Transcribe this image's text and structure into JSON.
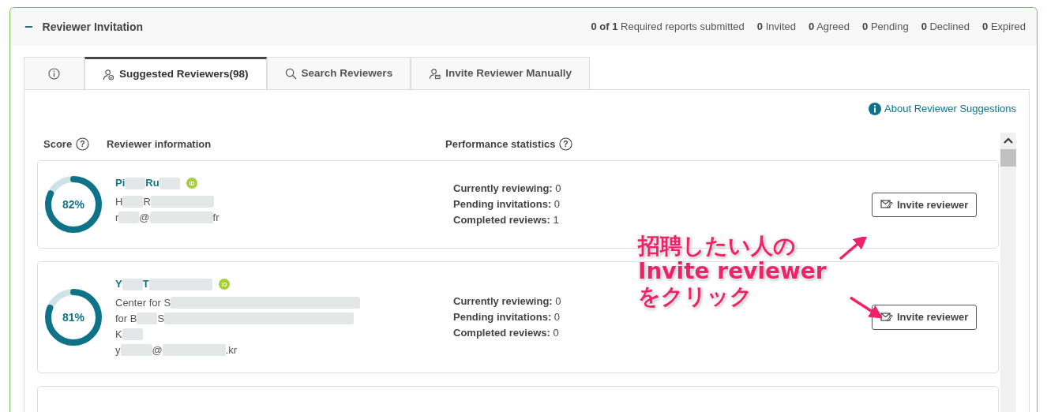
{
  "panel": {
    "collapse_symbol": "−",
    "title": "Reviewer Invitation",
    "stats": [
      {
        "count": "0 of 1",
        "label": "Required reports submitted"
      },
      {
        "count": "0",
        "label": "Invited"
      },
      {
        "count": "0",
        "label": "Agreed"
      },
      {
        "count": "0",
        "label": "Pending"
      },
      {
        "count": "0",
        "label": "Declined"
      },
      {
        "count": "0",
        "label": "Expired"
      }
    ]
  },
  "tabs": [
    {
      "kind": "info",
      "selected": false
    },
    {
      "kind": "suggested",
      "label": "Suggested Reviewers(98)",
      "selected": true
    },
    {
      "kind": "search",
      "label": "Search Reviewers",
      "selected": false
    },
    {
      "kind": "manual",
      "label": "Invite Reviewer Manually",
      "selected": false
    }
  ],
  "about_link": "About Reviewer Suggestions",
  "columns": [
    {
      "label": "Score",
      "help": "?"
    },
    {
      "label": "Reviewer information"
    },
    {
      "label": "Performance statistics",
      "help": "?"
    }
  ],
  "reviewers": [
    {
      "score": "82%",
      "level": 0.82,
      "orcid": "iD",
      "name": [
        {
          "kind": "text",
          "text": "Pi"
        },
        {
          "kind": "blur_s"
        },
        {
          "kind": "text",
          "text": "Ru"
        },
        {
          "kind": "blur_s"
        }
      ],
      "info_lines": [
        [
          {
            "kind": "text",
            "text": "H"
          },
          {
            "kind": "blur_s"
          },
          {
            "kind": "text",
            "text": "R"
          },
          {
            "kind": "blur_l"
          }
        ],
        [
          {
            "kind": "text",
            "text": "r"
          },
          {
            "kind": "blur_s"
          },
          {
            "kind": "text",
            "text": "@"
          },
          {
            "kind": "blur_l"
          },
          {
            "kind": "text",
            "text": "fr"
          }
        ]
      ],
      "stats": [
        {
          "label": "Currently reviewing:",
          "value": "0"
        },
        {
          "label": "Pending invitations:",
          "value": "0"
        },
        {
          "label": "Completed reviews:",
          "value": "1"
        }
      ],
      "button": "Invite reviewer"
    },
    {
      "score": "81%",
      "level": 0.81,
      "orcid": "iD",
      "name": [
        {
          "kind": "text",
          "text": "Y"
        },
        {
          "kind": "blur_s"
        },
        {
          "kind": "text",
          "text": "T"
        },
        {
          "kind": "blur_l"
        }
      ],
      "info_lines": [
        [
          {
            "kind": "text",
            "text": "Center for S"
          },
          {
            "kind": "blur_xl"
          }
        ],
        [
          {
            "kind": "text",
            "text": "for B"
          },
          {
            "kind": "blur_s"
          },
          {
            "kind": "text",
            "text": "S"
          },
          {
            "kind": "blur_xl"
          }
        ],
        [
          {
            "kind": "text",
            "text": "K"
          },
          {
            "kind": "blur_s"
          }
        ],
        [
          {
            "kind": "text",
            "text": "y"
          },
          {
            "kind": "blur_m"
          },
          {
            "kind": "text",
            "text": "@"
          },
          {
            "kind": "blur_l"
          },
          {
            "kind": "text",
            "text": ".kr"
          }
        ]
      ],
      "stats": [
        {
          "label": "Currently reviewing:",
          "value": "0"
        },
        {
          "label": "Pending invitations:",
          "value": "0"
        },
        {
          "label": "Completed reviews:",
          "value": "0"
        }
      ],
      "button": "Invite reviewer"
    }
  ],
  "annotation": {
    "lines": [
      "招聘したい人の",
      "Invite reviewer",
      "をクリック"
    ],
    "arrows": [
      {
        "kind": "up_right"
      },
      {
        "kind": "down_right"
      }
    ]
  }
}
